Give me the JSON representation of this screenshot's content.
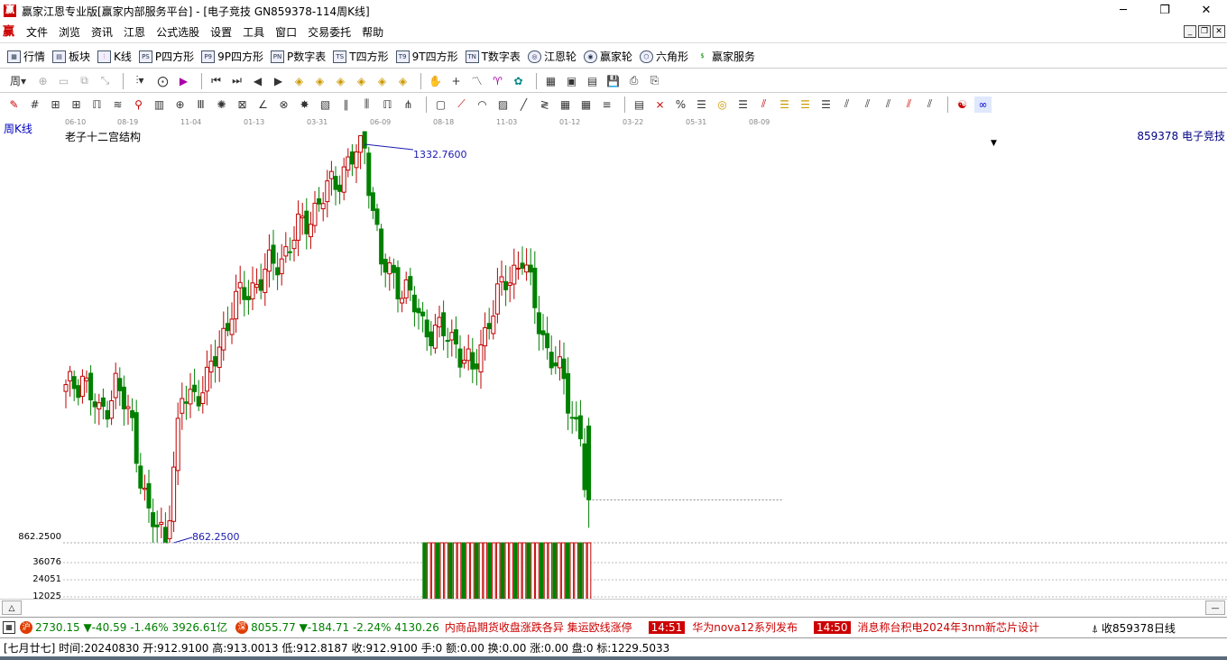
{
  "window": {
    "title": "赢家江恩专业版[赢家内部服务平台] - [电子竞技  GN859378-114周K线]",
    "minimize": "─",
    "maximize": "❐",
    "close": "✕"
  },
  "menu": {
    "logo": "赢",
    "items": [
      "文件",
      "浏览",
      "资讯",
      "江恩",
      "公式选股",
      "设置",
      "工具",
      "窗口",
      "交易委托",
      "帮助"
    ]
  },
  "toolbar1": {
    "items": [
      {
        "icon": "grid-icon",
        "label": "行情"
      },
      {
        "icon": "blocks-icon",
        "label": "板块"
      },
      {
        "icon": "kline-icon",
        "label": "K线"
      },
      {
        "icon": "ps-icon",
        "label": "P四方形",
        "glyph": "PS"
      },
      {
        "icon": "p9-icon",
        "label": "9P四方形",
        "glyph": "P9"
      },
      {
        "icon": "pn-icon",
        "label": "P数字表",
        "glyph": "PN"
      },
      {
        "icon": "ts-icon",
        "label": "T四方形",
        "glyph": "TS"
      },
      {
        "icon": "t9-icon",
        "label": "9T四方形",
        "glyph": "T9"
      },
      {
        "icon": "tn-icon",
        "label": "T数字表",
        "glyph": "TN"
      },
      {
        "icon": "gann-wheel-icon",
        "label": "江恩轮"
      },
      {
        "icon": "winner-wheel-icon",
        "label": "赢家轮"
      },
      {
        "icon": "hexagon-icon",
        "label": "六角形"
      },
      {
        "icon": "service-icon",
        "label": "赢家服务"
      }
    ]
  },
  "chart": {
    "period": "周K线",
    "indicator": "老子十二宫结构",
    "stock": "859378 电子竞技",
    "high_label": "1332.7600",
    "low_label": "862.2500",
    "axis_price": "862.2500",
    "volume_axis": [
      "36076",
      "24051",
      "12025"
    ],
    "date_ticks": [
      "06-10",
      "08-19",
      "11-04",
      "01-13",
      "03-31",
      "06-09",
      "08-18",
      "11-03",
      "01-12",
      "03-22",
      "05-31",
      "08-09"
    ]
  },
  "chart_data": {
    "type": "candlestick",
    "title": "",
    "price_range": [
      862.25,
      1332.76
    ],
    "high": 1332.76,
    "low": 862.25,
    "last_close": 912.91
  },
  "ticker": {
    "sh_badge": "沪",
    "sh_value": "2730.15",
    "sh_change": "▼-40.59",
    "sh_pct": "-1.46%",
    "sh_amount": "3926.61亿",
    "sz_badge": "深",
    "sz_value": "8055.77",
    "sz_change": "▼-184.71",
    "sz_pct": "-2.24%",
    "sz_amount": "4130.26",
    "news1": "内商品期货收盘涨跌各异 集运欧线涨停",
    "time2": "14:51",
    "news2": "华为nova12系列发布",
    "time3": "14:50",
    "news3": "消息称台积电2024年3nm新芯片设计",
    "status_right": "收859378日线"
  },
  "status": {
    "text": "[七月廿七] 时间:20240830 开:912.9100 高:913.0013 低:912.8187 收:912.9100 手:0 额:0.00 换:0.00 涨:0.00 盘:0 标:1229.5033"
  },
  "colors": {
    "up": "#c00000",
    "down": "#008000",
    "line": "#1a1ab0"
  }
}
